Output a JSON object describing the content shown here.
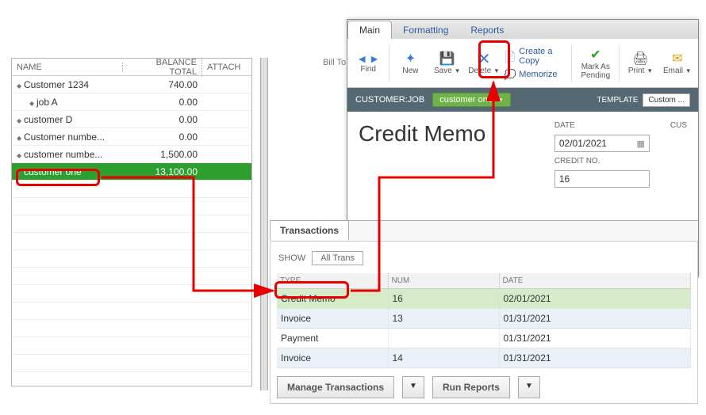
{
  "customer_list": {
    "headers": {
      "name": "NAME",
      "balance": "BALANCE TOTAL",
      "attach": "ATTACH"
    },
    "rows": [
      {
        "name": "Customer 1234",
        "balance": "740.00",
        "indent": 0
      },
      {
        "name": "job A",
        "balance": "0.00",
        "indent": 1
      },
      {
        "name": "customer D",
        "balance": "0.00",
        "indent": 0
      },
      {
        "name": "Customer numbe...",
        "balance": "0.00",
        "indent": 0
      },
      {
        "name": "customer numbe...",
        "balance": "1,500.00",
        "indent": 0
      },
      {
        "name": "customer one",
        "balance": "13,100.00",
        "indent": 0,
        "selected": true
      }
    ]
  },
  "bill_to_label": "Bill To",
  "credit_window": {
    "tabs": {
      "main": "Main",
      "formatting": "Formatting",
      "reports": "Reports"
    },
    "toolbar": {
      "find": "Find",
      "new": "New",
      "save": "Save",
      "delete": "Delete",
      "create_copy": "Create a Copy",
      "memorize": "Memorize",
      "mark_pending": "Mark As Pending",
      "print": "Print",
      "email": "Email"
    },
    "customer_job_label": "CUSTOMER:JOB",
    "customer_job_value": "customer one",
    "template_label": "TEMPLATE",
    "template_value": "Custom ...",
    "title": "Credit Memo",
    "date_label": "DATE",
    "date_value": "02/01/2021",
    "credit_no_label": "CREDIT NO.",
    "credit_no_value": "16",
    "cust_cutoff": "CUS"
  },
  "transactions": {
    "tab_label": "Transactions",
    "show_label": "SHOW",
    "show_value": "All Trans",
    "headers": {
      "type": "TYPE",
      "num": "NUM",
      "date": "DATE"
    },
    "rows": [
      {
        "type": "Credit Memo",
        "num": "16",
        "date": "02/01/2021",
        "cls": "green"
      },
      {
        "type": "Invoice",
        "num": "13",
        "date": "01/31/2021",
        "cls": "blue"
      },
      {
        "type": "Payment",
        "num": "",
        "date": "01/31/2021",
        "cls": ""
      },
      {
        "type": "Invoice",
        "num": "14",
        "date": "01/31/2021",
        "cls": "blue"
      }
    ],
    "manage_btn": "Manage Transactions",
    "run_btn": "Run Reports"
  }
}
